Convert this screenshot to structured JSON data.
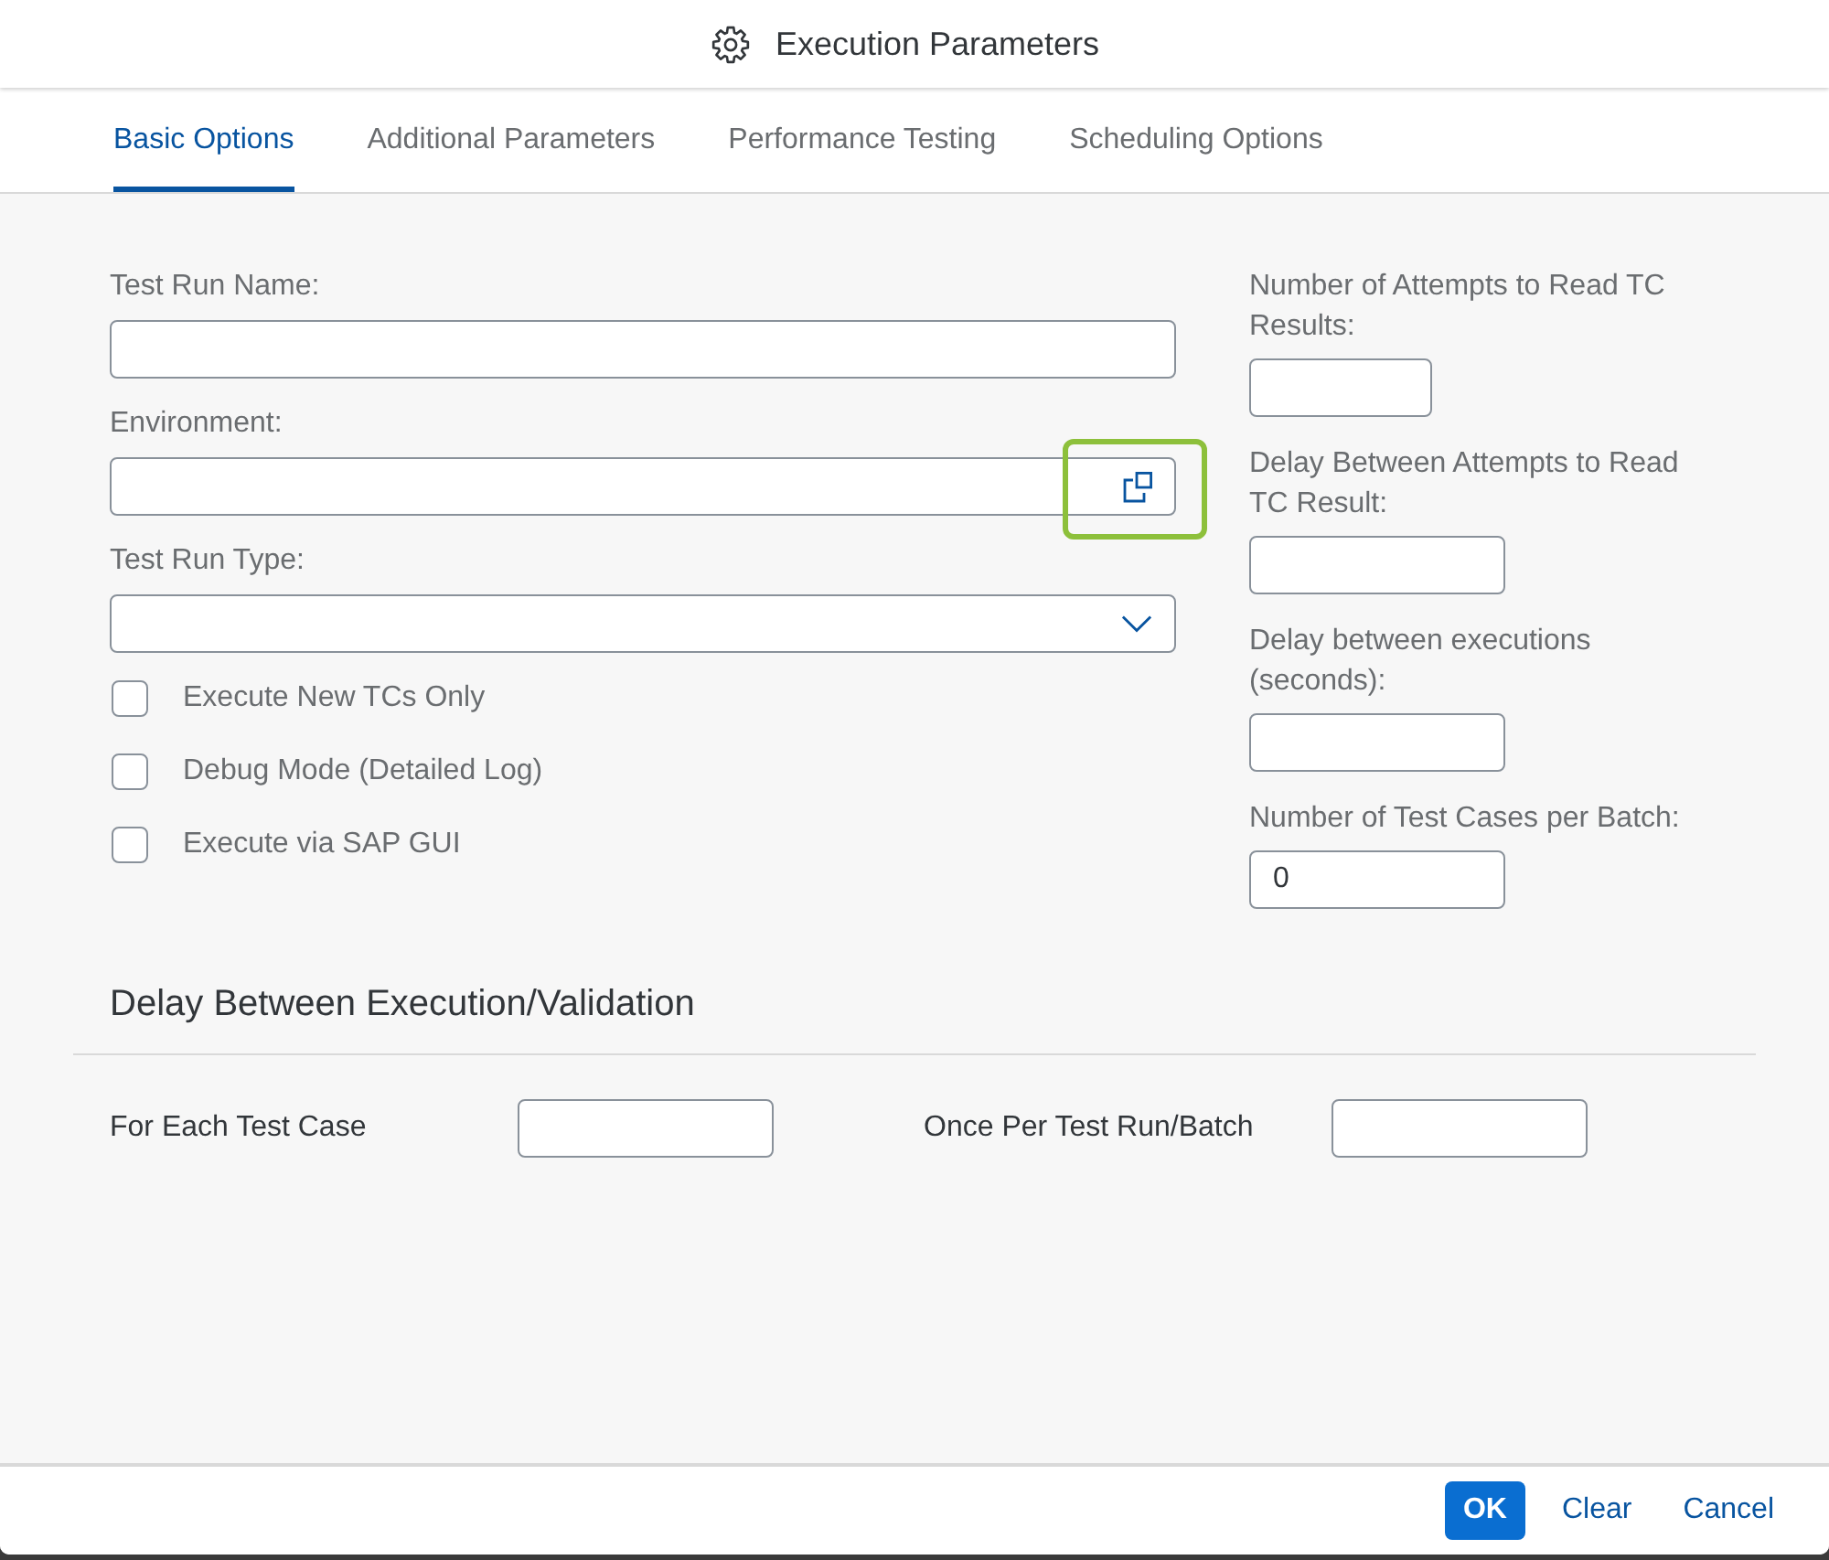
{
  "dialog": {
    "title": "Execution Parameters"
  },
  "tabs": [
    {
      "label": "Basic Options",
      "selected": true
    },
    {
      "label": "Additional Parameters",
      "selected": false
    },
    {
      "label": "Performance Testing",
      "selected": false
    },
    {
      "label": "Scheduling Options",
      "selected": false
    }
  ],
  "left_fields": [
    {
      "kind": "text",
      "label": "Test Run Name:",
      "highlighted": false
    },
    {
      "kind": "value_help",
      "label": "Environment:",
      "highlighted": true
    },
    {
      "kind": "select",
      "label": "Test Run Type:",
      "highlighted": false
    }
  ],
  "checkboxes": [
    {
      "label": "Execute New TCs Only",
      "checked": false
    },
    {
      "label": "Debug Mode (Detailed Log)",
      "checked": false
    },
    {
      "label": "Execute via SAP GUI",
      "checked": false
    }
  ],
  "right_fields": [
    {
      "kind": "short",
      "label": "Number of Attempts to Read TC Results:"
    },
    {
      "kind": "medium",
      "label": "Delay Between Attempts to Read TC Result:"
    },
    {
      "kind": "medium",
      "label": "Delay between executions (seconds):"
    },
    {
      "kind": "medium",
      "label": "Number of Test Cases per Batch:",
      "value": "0"
    }
  ],
  "delay_section": {
    "title": "Delay Between Execution/Validation",
    "fields": [
      {
        "label": "For Each Test Case"
      },
      {
        "label": "Once Per Test Run/Batch"
      }
    ]
  },
  "footer": {
    "buttons": [
      {
        "label": "OK",
        "kind": "emphasized"
      },
      {
        "label": "Clear",
        "kind": "transparent"
      },
      {
        "label": "Cancel",
        "kind": "transparent"
      }
    ]
  }
}
